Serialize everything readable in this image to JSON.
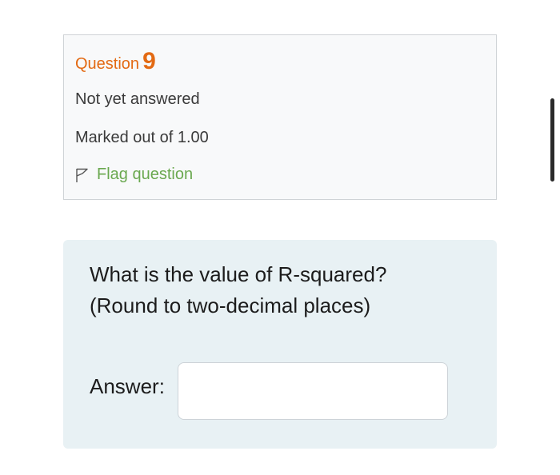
{
  "question_info": {
    "label": "Question",
    "number": "9",
    "state": "Not yet answered",
    "grade": "Marked out of 1.00",
    "flag_label": "Flag question",
    "flag_icon": "flag-icon"
  },
  "question": {
    "line1": "What is the value of R-squared?",
    "line2": "(Round to two-decimal places)",
    "answer_label": "Answer:",
    "answer_value": ""
  },
  "colors": {
    "question_heading": "#e36a13",
    "flag_link": "#6aa84f",
    "info_background": "#f8f9fa",
    "question_background": "#e8f1f4"
  }
}
